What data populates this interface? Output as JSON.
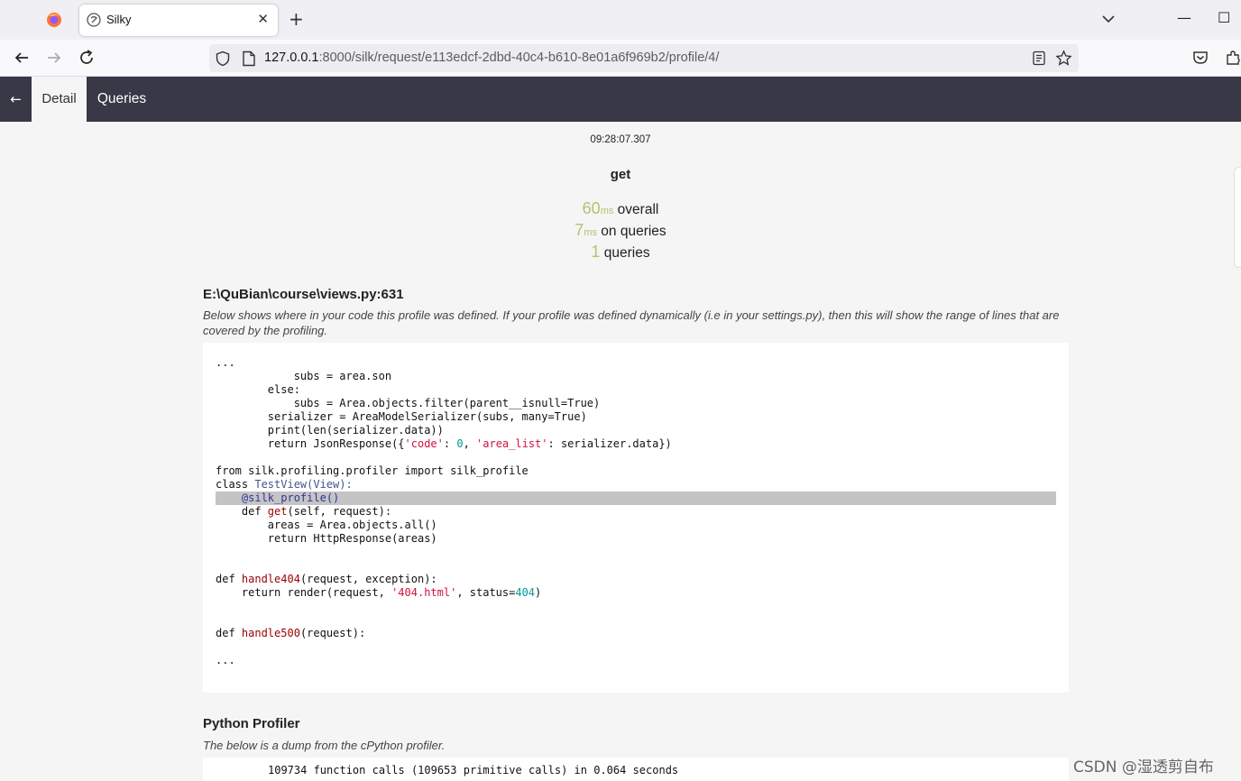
{
  "browser": {
    "tab_title": "Silky",
    "url_host": "127.0.0.1",
    "url_rest": ":8000/silk/request/e113edcf-2dbd-40c4-b610-8e01a6f969b2/profile/4/",
    "new_tab": "+",
    "close_tab": "✕",
    "window": {
      "minimize": "—",
      "maximize": "☐"
    }
  },
  "silky_nav": {
    "back": "←",
    "tabs": [
      {
        "label": "Detail"
      },
      {
        "label": "Queries"
      }
    ]
  },
  "summary": {
    "time": "09:28:07.307",
    "method": "get",
    "overall_value": "60",
    "overall_unit": "ms",
    "overall_label": " overall",
    "queries_time_value": "7",
    "queries_time_unit": "ms",
    "queries_time_label": " on queries",
    "query_count_value": "1",
    "query_count_label": " queries"
  },
  "profile_source": {
    "title": "E:\\QuBian\\course\\views.py:631",
    "description": "Below shows where in your code this profile was defined. If your profile was defined dynamically (i.e in your settings.py), then this will show the range of lines that are covered by the profiling.",
    "code_lines": [
      "...",
      "            subs = area.son",
      "        else:",
      "            subs = Area.objects.filter(parent__isnull=True)",
      "        serializer = AreaModelSerializer(subs, many=True)",
      "        print(len(serializer.data))",
      "        return JsonResponse({'code': 0, 'area_list': serializer.data})",
      "",
      "from silk.profiling.profiler import silk_profile",
      "class TestView(View):",
      "    @silk_profile()",
      "    def get(self, request):",
      "        areas = Area.objects.all()",
      "        return HttpResponse(areas)",
      "",
      "",
      "def handle404(request, exception):",
      "    return render(request, '404.html', status=404)",
      "",
      "",
      "def handle500(request):",
      "",
      "..."
    ],
    "highlighted_line": "@silk_profile()"
  },
  "python_profiler": {
    "title": "Python Profiler",
    "description": "The below is a dump from the cPython profiler.",
    "first_line": "109734 function calls (109653 primitive calls) in 0.064 seconds"
  },
  "watermark": "CSDN @湿透剪自布",
  "colors": {
    "nav_bg": "#383846",
    "accent": "#b9c06c",
    "highlight": "#c4c4c4"
  }
}
